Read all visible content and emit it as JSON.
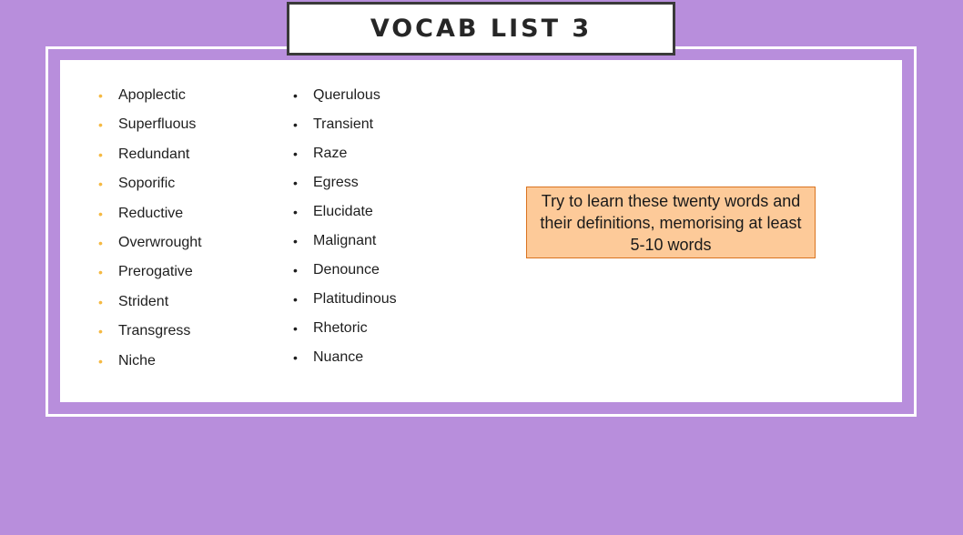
{
  "title": "VOCAB LIST 3",
  "colors": {
    "background": "#b88edc",
    "panel": "#ffffff",
    "title_border": "#3a3a3a",
    "bullet_col1": "#f5b942",
    "bullet_col2": "#1e1e1e",
    "note_fill": "#fdca99",
    "note_border": "#d9731f"
  },
  "bullet_glyph": "•",
  "column1": [
    "Apoplectic",
    "Superfluous",
    "Redundant",
    "Soporific",
    "Reductive",
    "Overwrought",
    "Prerogative",
    "Strident",
    "Transgress",
    "Niche"
  ],
  "column2": [
    "Querulous",
    "Transient",
    "Raze",
    "Egress",
    "Elucidate",
    "Malignant",
    "Denounce",
    "Platitudinous",
    "Rhetoric",
    "Nuance"
  ],
  "note": {
    "lines": [
      "Try to learn these twenty words and",
      "their definitions, memorising at least",
      "5-10 words"
    ]
  }
}
